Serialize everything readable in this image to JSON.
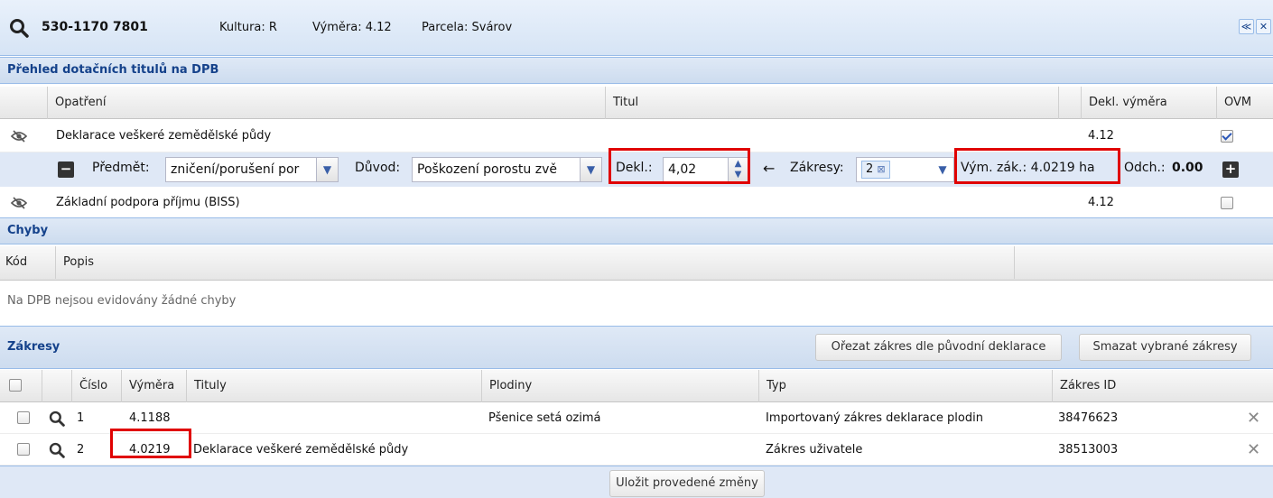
{
  "header": {
    "parcel_id": "530-1170 7801",
    "kultura": "Kultura: R",
    "vymera": "Výměra: 4.12",
    "parcela": "Parcela: Svárov"
  },
  "prehled": {
    "title": "Přehled dotačních titulů na DPB",
    "columns": [
      "Opatření",
      "Titul",
      "Dekl. výměra",
      "OVM"
    ],
    "rows": [
      {
        "opatreni": "Deklarace veškeré zemědělské půdy",
        "dekl": "4.12",
        "ovm_checked": true
      },
      {
        "opatreni": "Základní podpora příjmu (BISS)",
        "dekl": "4.12",
        "ovm_checked": false
      }
    ],
    "subrow": {
      "predmet_label": "Předmět:",
      "predmet_value": "zničení/porušení por",
      "duvod_label": "Důvod:",
      "duvod_value": "Poškození porostu zvě",
      "dekl_label": "Dekl.:",
      "dekl_value": "4,02",
      "arrow": "←",
      "zakresy_label": "Zákresy:",
      "zakresy_tag": "2",
      "vym_zak": "Vým. zák.: 4.0219 ha",
      "odch_label": "Odch.:",
      "odch_value": "0.00"
    }
  },
  "chyby": {
    "title": "Chyby",
    "columns": [
      "Kód",
      "Popis"
    ],
    "empty_text": "Na DPB nejsou evidovány žádné chyby"
  },
  "zakresy": {
    "title": "Zákresy",
    "btn_orezat": "Ořezat zákres dle původní deklarace",
    "btn_smazat": "Smazat vybrané zákresy",
    "columns": [
      "Číslo",
      "Výměra",
      "Tituly",
      "Plodiny",
      "Typ",
      "Zákres ID"
    ],
    "rows": [
      {
        "cislo": "1",
        "vymera": "4.1188",
        "tituly": "",
        "plodiny": "Pšenice setá ozimá",
        "typ": "Importovaný zákres deklarace plodin",
        "id": "38476623"
      },
      {
        "cislo": "2",
        "vymera": "4.0219",
        "tituly": "Deklarace veškeré zemědělské půdy",
        "plodiny": "",
        "typ": "Zákres uživatele",
        "id": "38513003"
      }
    ]
  },
  "footer": {
    "save_label": "Uložit provedené změny"
  }
}
